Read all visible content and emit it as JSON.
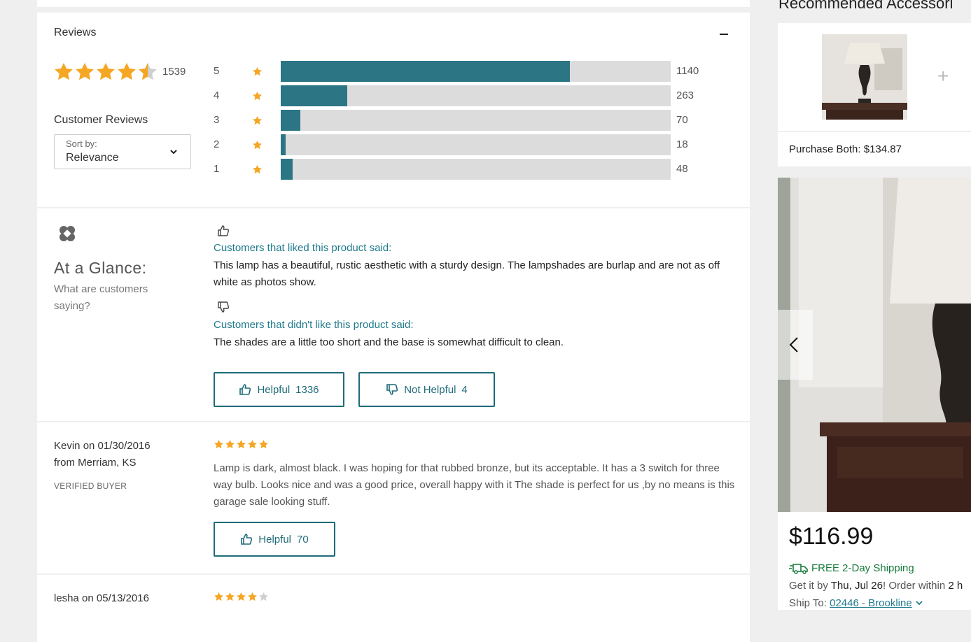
{
  "reviews": {
    "title": "Reviews",
    "average_rating": 4.5,
    "total_count": "1539",
    "customer_reviews_label": "Customer Reviews",
    "sort": {
      "label": "Sort by:",
      "value": "Relevance"
    },
    "histogram": [
      {
        "stars": "5",
        "count": "1140",
        "fraction": 0.741
      },
      {
        "stars": "4",
        "count": "263",
        "fraction": 0.171
      },
      {
        "stars": "3",
        "count": "70",
        "fraction": 0.05
      },
      {
        "stars": "2",
        "count": "18",
        "fraction": 0.012
      },
      {
        "stars": "1",
        "count": "48",
        "fraction": 0.031
      }
    ]
  },
  "glance": {
    "title": "At a Glance:",
    "subtitle": "What are customers saying?",
    "liked_heading": "Customers that liked this product said:",
    "liked_text": "This lamp has a beautiful, rustic aesthetic with a sturdy design. The lampshades are burlap and are not as off white as photos show.",
    "disliked_heading": "Customers that didn't like this product said:",
    "disliked_text": "The shades are a little too short and the base is somewhat difficult to clean.",
    "helpful_label": "Helpful",
    "helpful_count": "1336",
    "not_helpful_label": "Not Helpful",
    "not_helpful_count": "4"
  },
  "review_list": [
    {
      "author": "Kevin on 01/30/2016",
      "location": "from Merriam, KS",
      "badge": "VERIFIED BUYER",
      "rating": 5,
      "body": "Lamp is dark, almost black. I was hoping for that rubbed bronze, but its acceptable. It has a 3 switch for three way bulb. Looks nice and was a good price, overall happy with it The shade is perfect for us ,by no means is this garage sale looking stuff.",
      "helpful_label": "Helpful",
      "helpful_count": "70"
    },
    {
      "author": "lesha on 05/13/2016",
      "rating": 4
    }
  ],
  "sidebar": {
    "recommended_title": "Recommended Accessori",
    "purchase_both": "Purchase Both: $134.87",
    "price": "$116.99",
    "shipping": "FREE 2-Day Shipping",
    "get_it_by_prefix": "Get it by ",
    "get_it_by_date": "Thu, Jul 26",
    "order_within": "! Order within ",
    "order_within_time": "2 h",
    "ship_to_label": "Ship To: ",
    "ship_to_value": "02446 - Brookline"
  },
  "colors": {
    "accent": "#1f7a8c",
    "bar_fill": "#2b7585",
    "bar_track": "#dcdcdc",
    "star": "#f5a623",
    "star_empty": "#d0d0d0",
    "shipping_green": "#157a3a"
  }
}
